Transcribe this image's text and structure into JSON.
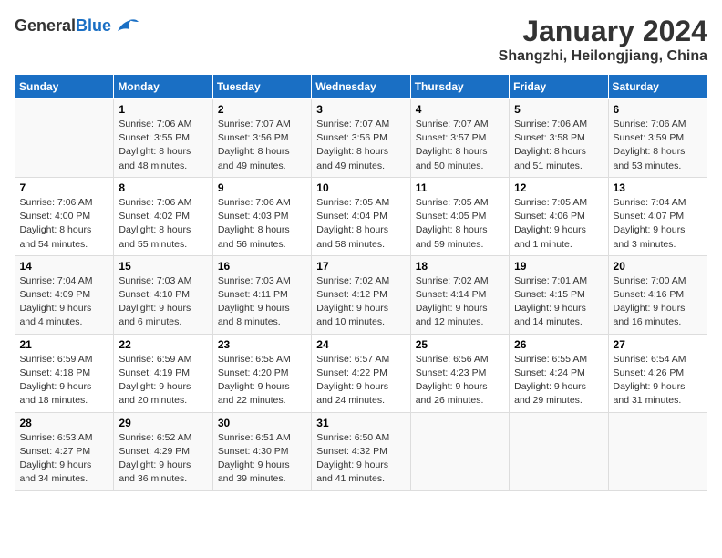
{
  "header": {
    "logo_general": "General",
    "logo_blue": "Blue",
    "month": "January 2024",
    "location": "Shangzhi, Heilongjiang, China"
  },
  "weekdays": [
    "Sunday",
    "Monday",
    "Tuesday",
    "Wednesday",
    "Thursday",
    "Friday",
    "Saturday"
  ],
  "weeks": [
    [
      {
        "day": "",
        "sunrise": "",
        "sunset": "",
        "daylight": ""
      },
      {
        "day": "1",
        "sunrise": "Sunrise: 7:06 AM",
        "sunset": "Sunset: 3:55 PM",
        "daylight": "Daylight: 8 hours and 48 minutes."
      },
      {
        "day": "2",
        "sunrise": "Sunrise: 7:07 AM",
        "sunset": "Sunset: 3:56 PM",
        "daylight": "Daylight: 8 hours and 49 minutes."
      },
      {
        "day": "3",
        "sunrise": "Sunrise: 7:07 AM",
        "sunset": "Sunset: 3:56 PM",
        "daylight": "Daylight: 8 hours and 49 minutes."
      },
      {
        "day": "4",
        "sunrise": "Sunrise: 7:07 AM",
        "sunset": "Sunset: 3:57 PM",
        "daylight": "Daylight: 8 hours and 50 minutes."
      },
      {
        "day": "5",
        "sunrise": "Sunrise: 7:06 AM",
        "sunset": "Sunset: 3:58 PM",
        "daylight": "Daylight: 8 hours and 51 minutes."
      },
      {
        "day": "6",
        "sunrise": "Sunrise: 7:06 AM",
        "sunset": "Sunset: 3:59 PM",
        "daylight": "Daylight: 8 hours and 53 minutes."
      }
    ],
    [
      {
        "day": "7",
        "sunrise": "Sunrise: 7:06 AM",
        "sunset": "Sunset: 4:00 PM",
        "daylight": "Daylight: 8 hours and 54 minutes."
      },
      {
        "day": "8",
        "sunrise": "Sunrise: 7:06 AM",
        "sunset": "Sunset: 4:02 PM",
        "daylight": "Daylight: 8 hours and 55 minutes."
      },
      {
        "day": "9",
        "sunrise": "Sunrise: 7:06 AM",
        "sunset": "Sunset: 4:03 PM",
        "daylight": "Daylight: 8 hours and 56 minutes."
      },
      {
        "day": "10",
        "sunrise": "Sunrise: 7:05 AM",
        "sunset": "Sunset: 4:04 PM",
        "daylight": "Daylight: 8 hours and 58 minutes."
      },
      {
        "day": "11",
        "sunrise": "Sunrise: 7:05 AM",
        "sunset": "Sunset: 4:05 PM",
        "daylight": "Daylight: 8 hours and 59 minutes."
      },
      {
        "day": "12",
        "sunrise": "Sunrise: 7:05 AM",
        "sunset": "Sunset: 4:06 PM",
        "daylight": "Daylight: 9 hours and 1 minute."
      },
      {
        "day": "13",
        "sunrise": "Sunrise: 7:04 AM",
        "sunset": "Sunset: 4:07 PM",
        "daylight": "Daylight: 9 hours and 3 minutes."
      }
    ],
    [
      {
        "day": "14",
        "sunrise": "Sunrise: 7:04 AM",
        "sunset": "Sunset: 4:09 PM",
        "daylight": "Daylight: 9 hours and 4 minutes."
      },
      {
        "day": "15",
        "sunrise": "Sunrise: 7:03 AM",
        "sunset": "Sunset: 4:10 PM",
        "daylight": "Daylight: 9 hours and 6 minutes."
      },
      {
        "day": "16",
        "sunrise": "Sunrise: 7:03 AM",
        "sunset": "Sunset: 4:11 PM",
        "daylight": "Daylight: 9 hours and 8 minutes."
      },
      {
        "day": "17",
        "sunrise": "Sunrise: 7:02 AM",
        "sunset": "Sunset: 4:12 PM",
        "daylight": "Daylight: 9 hours and 10 minutes."
      },
      {
        "day": "18",
        "sunrise": "Sunrise: 7:02 AM",
        "sunset": "Sunset: 4:14 PM",
        "daylight": "Daylight: 9 hours and 12 minutes."
      },
      {
        "day": "19",
        "sunrise": "Sunrise: 7:01 AM",
        "sunset": "Sunset: 4:15 PM",
        "daylight": "Daylight: 9 hours and 14 minutes."
      },
      {
        "day": "20",
        "sunrise": "Sunrise: 7:00 AM",
        "sunset": "Sunset: 4:16 PM",
        "daylight": "Daylight: 9 hours and 16 minutes."
      }
    ],
    [
      {
        "day": "21",
        "sunrise": "Sunrise: 6:59 AM",
        "sunset": "Sunset: 4:18 PM",
        "daylight": "Daylight: 9 hours and 18 minutes."
      },
      {
        "day": "22",
        "sunrise": "Sunrise: 6:59 AM",
        "sunset": "Sunset: 4:19 PM",
        "daylight": "Daylight: 9 hours and 20 minutes."
      },
      {
        "day": "23",
        "sunrise": "Sunrise: 6:58 AM",
        "sunset": "Sunset: 4:20 PM",
        "daylight": "Daylight: 9 hours and 22 minutes."
      },
      {
        "day": "24",
        "sunrise": "Sunrise: 6:57 AM",
        "sunset": "Sunset: 4:22 PM",
        "daylight": "Daylight: 9 hours and 24 minutes."
      },
      {
        "day": "25",
        "sunrise": "Sunrise: 6:56 AM",
        "sunset": "Sunset: 4:23 PM",
        "daylight": "Daylight: 9 hours and 26 minutes."
      },
      {
        "day": "26",
        "sunrise": "Sunrise: 6:55 AM",
        "sunset": "Sunset: 4:24 PM",
        "daylight": "Daylight: 9 hours and 29 minutes."
      },
      {
        "day": "27",
        "sunrise": "Sunrise: 6:54 AM",
        "sunset": "Sunset: 4:26 PM",
        "daylight": "Daylight: 9 hours and 31 minutes."
      }
    ],
    [
      {
        "day": "28",
        "sunrise": "Sunrise: 6:53 AM",
        "sunset": "Sunset: 4:27 PM",
        "daylight": "Daylight: 9 hours and 34 minutes."
      },
      {
        "day": "29",
        "sunrise": "Sunrise: 6:52 AM",
        "sunset": "Sunset: 4:29 PM",
        "daylight": "Daylight: 9 hours and 36 minutes."
      },
      {
        "day": "30",
        "sunrise": "Sunrise: 6:51 AM",
        "sunset": "Sunset: 4:30 PM",
        "daylight": "Daylight: 9 hours and 39 minutes."
      },
      {
        "day": "31",
        "sunrise": "Sunrise: 6:50 AM",
        "sunset": "Sunset: 4:32 PM",
        "daylight": "Daylight: 9 hours and 41 minutes."
      },
      {
        "day": "",
        "sunrise": "",
        "sunset": "",
        "daylight": ""
      },
      {
        "day": "",
        "sunrise": "",
        "sunset": "",
        "daylight": ""
      },
      {
        "day": "",
        "sunrise": "",
        "sunset": "",
        "daylight": ""
      }
    ]
  ]
}
